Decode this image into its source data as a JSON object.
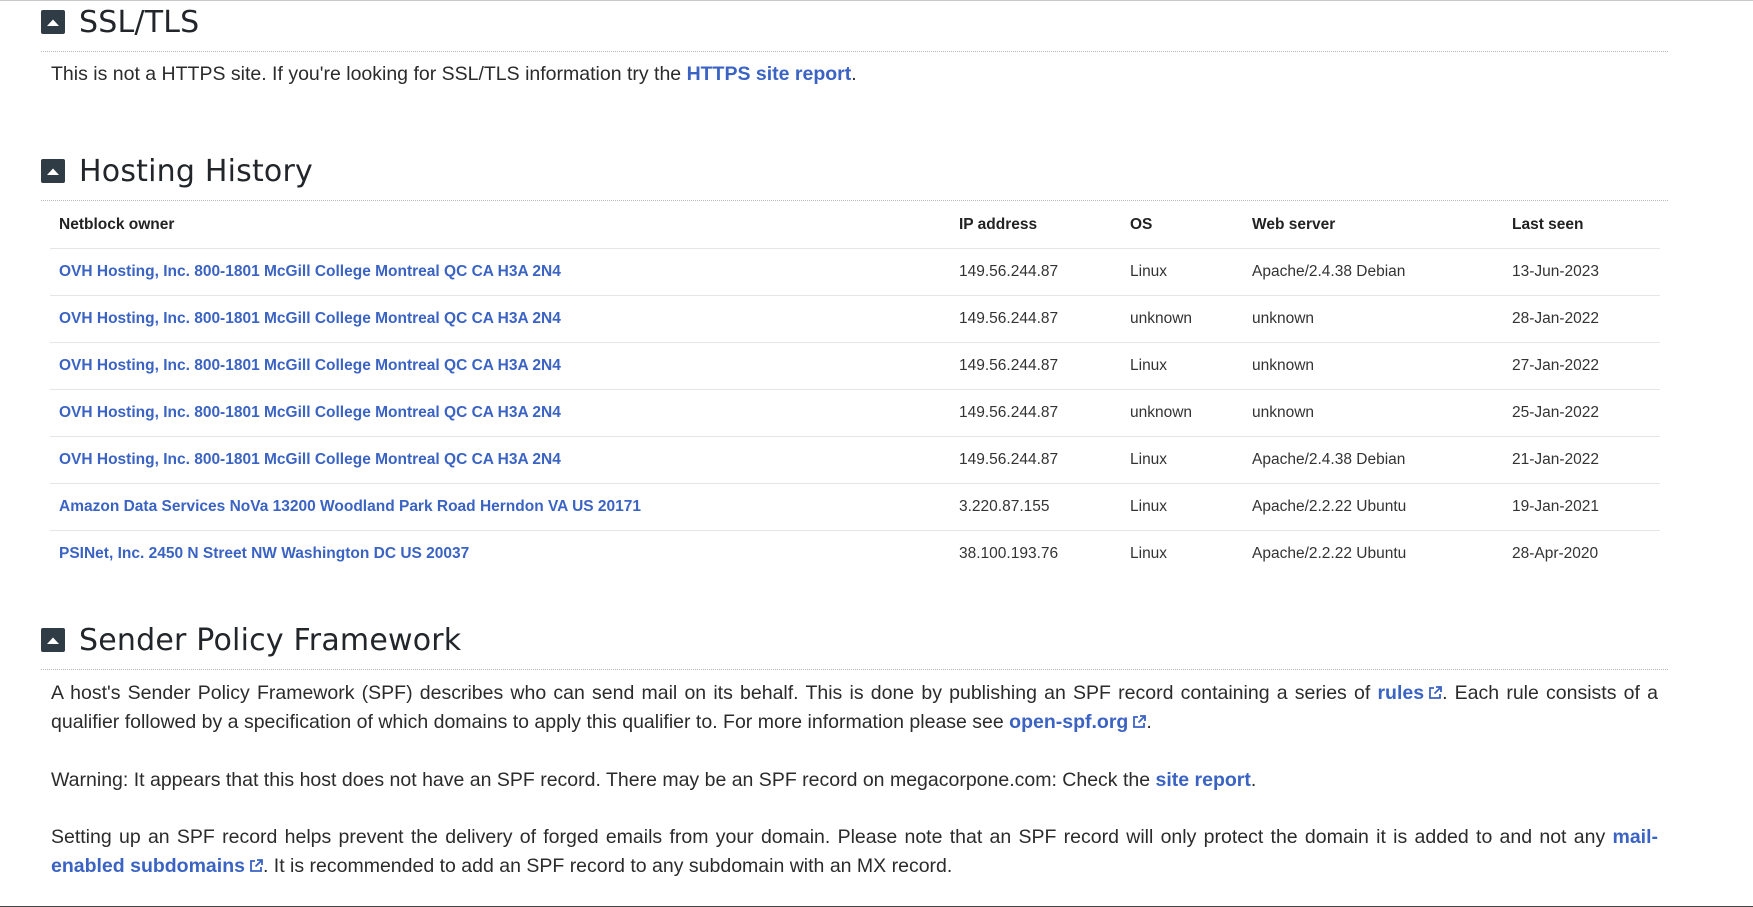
{
  "ssl": {
    "title": "SSL/TLS",
    "text_before": "This is not a HTTPS site. If you're looking for SSL/TLS information try the ",
    "link": "HTTPS site report",
    "text_after": "."
  },
  "hosting": {
    "title": "Hosting History",
    "columns": [
      "Netblock owner",
      "IP address",
      "OS",
      "Web server",
      "Last seen"
    ],
    "rows": [
      {
        "owner": "OVH Hosting, Inc. 800-1801 McGill College Montreal QC CA H3A 2N4",
        "ip": "149.56.244.87",
        "os": "Linux",
        "server": "Apache/2.4.38 Debian",
        "seen": "13-Jun-2023"
      },
      {
        "owner": "OVH Hosting, Inc. 800-1801 McGill College Montreal QC CA H3A 2N4",
        "ip": "149.56.244.87",
        "os": "unknown",
        "server": "unknown",
        "seen": "28-Jan-2022"
      },
      {
        "owner": "OVH Hosting, Inc. 800-1801 McGill College Montreal QC CA H3A 2N4",
        "ip": "149.56.244.87",
        "os": "Linux",
        "server": "unknown",
        "seen": "27-Jan-2022"
      },
      {
        "owner": "OVH Hosting, Inc. 800-1801 McGill College Montreal QC CA H3A 2N4",
        "ip": "149.56.244.87",
        "os": "unknown",
        "server": "unknown",
        "seen": "25-Jan-2022"
      },
      {
        "owner": "OVH Hosting, Inc. 800-1801 McGill College Montreal QC CA H3A 2N4",
        "ip": "149.56.244.87",
        "os": "Linux",
        "server": "Apache/2.4.38 Debian",
        "seen": "21-Jan-2022"
      },
      {
        "owner": "Amazon Data Services NoVa 13200 Woodland Park Road Herndon VA US 20171",
        "ip": "3.220.87.155",
        "os": "Linux",
        "server": "Apache/2.2.22 Ubuntu",
        "seen": "19-Jan-2021"
      },
      {
        "owner": "PSINet, Inc. 2450 N Street NW Washington DC US 20037",
        "ip": "38.100.193.76",
        "os": "Linux",
        "server": "Apache/2.2.22 Ubuntu",
        "seen": "28-Apr-2020"
      }
    ]
  },
  "spf": {
    "title": "Sender Policy Framework",
    "p1_a": "A host's Sender Policy Framework (SPF) describes who can send mail on its behalf. This is done by publishing an SPF record containing a series of ",
    "p1_link1": "rules",
    "p1_b": ". Each rule consists of a qualifier followed by a specification of which domains to apply this qualifier to. For more information please see ",
    "p1_link2": "open-spf.org",
    "p1_c": ".",
    "p2_a": "Warning: It appears that this host does not have an SPF record. There may be an SPF record on megacorpone.com: Check the ",
    "p2_link": "site report",
    "p2_b": ".",
    "p3_a": "Setting up an SPF record helps prevent the delivery of forged emails from your domain. Please note that an SPF record will only protect the domain it is added to and not any ",
    "p3_link": "mail-enabled subdomains",
    "p3_b": ". It is recommended to add an SPF record to any subdomain with an MX record."
  },
  "icons": {
    "toggle": "chevron-up-icon",
    "external": "external-link-icon"
  },
  "colors": {
    "link": "#3a63c4",
    "toggle_bg": "#2f3b45"
  }
}
